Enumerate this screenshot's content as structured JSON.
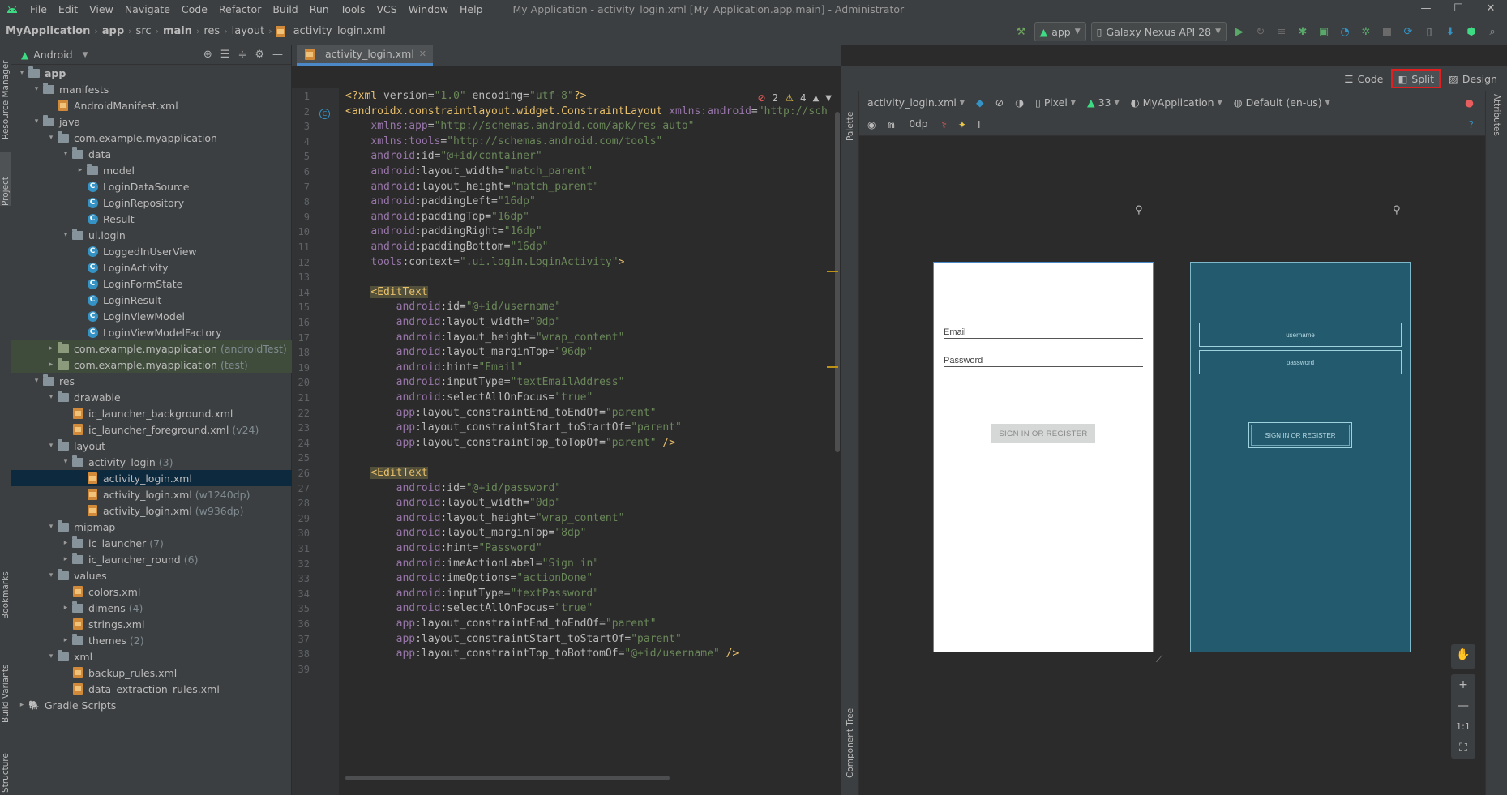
{
  "menubar": {
    "items": [
      "File",
      "Edit",
      "View",
      "Navigate",
      "Code",
      "Refactor",
      "Build",
      "Run",
      "Tools",
      "VCS",
      "Window",
      "Help"
    ],
    "window_title": "My Application - activity_login.xml [My_Application.app.main] - Administrator",
    "controls": [
      "—",
      "☐",
      "✕"
    ]
  },
  "breadcrumb": {
    "items": [
      "MyApplication",
      "app",
      "src",
      "main",
      "res",
      "layout",
      "activity_login.xml"
    ]
  },
  "toolbar": {
    "run_config": "app",
    "device": "Galaxy Nexus API 28"
  },
  "left_strip": {
    "top_tabs": [
      "Resource Manager",
      "Project"
    ],
    "bottom_tabs": [
      "Bookmarks",
      "Build Variants",
      "Structure"
    ]
  },
  "project": {
    "view_mode": "Android",
    "tree": [
      {
        "indent": 0,
        "arrow": "▾",
        "icon": "folder",
        "label": "app",
        "bold": true
      },
      {
        "indent": 1,
        "arrow": "▾",
        "icon": "folder",
        "label": "manifests"
      },
      {
        "indent": 2,
        "arrow": "",
        "icon": "xml",
        "label": "AndroidManifest.xml"
      },
      {
        "indent": 1,
        "arrow": "▾",
        "icon": "folder",
        "label": "java"
      },
      {
        "indent": 2,
        "arrow": "▾",
        "icon": "folder",
        "label": "com.example.myapplication"
      },
      {
        "indent": 3,
        "arrow": "▾",
        "icon": "folder",
        "label": "data"
      },
      {
        "indent": 4,
        "arrow": "▸",
        "icon": "folder",
        "label": "model"
      },
      {
        "indent": 4,
        "arrow": "",
        "icon": "class",
        "label": "LoginDataSource"
      },
      {
        "indent": 4,
        "arrow": "",
        "icon": "class",
        "label": "LoginRepository"
      },
      {
        "indent": 4,
        "arrow": "",
        "icon": "class",
        "label": "Result"
      },
      {
        "indent": 3,
        "arrow": "▾",
        "icon": "folder",
        "label": "ui.login"
      },
      {
        "indent": 4,
        "arrow": "",
        "icon": "class",
        "label": "LoggedInUserView"
      },
      {
        "indent": 4,
        "arrow": "",
        "icon": "class",
        "label": "LoginActivity"
      },
      {
        "indent": 4,
        "arrow": "",
        "icon": "class",
        "label": "LoginFormState"
      },
      {
        "indent": 4,
        "arrow": "",
        "icon": "class",
        "label": "LoginResult"
      },
      {
        "indent": 4,
        "arrow": "",
        "icon": "class",
        "label": "LoginViewModel"
      },
      {
        "indent": 4,
        "arrow": "",
        "icon": "class",
        "label": "LoginViewModelFactory"
      },
      {
        "indent": 2,
        "arrow": "▸",
        "icon": "folder-green",
        "label": "com.example.myapplication",
        "suffix": "(androidTest)",
        "alt": true
      },
      {
        "indent": 2,
        "arrow": "▸",
        "icon": "folder-green",
        "label": "com.example.myapplication",
        "suffix": "(test)",
        "alt": true
      },
      {
        "indent": 1,
        "arrow": "▾",
        "icon": "folder",
        "label": "res"
      },
      {
        "indent": 2,
        "arrow": "▾",
        "icon": "folder",
        "label": "drawable"
      },
      {
        "indent": 3,
        "arrow": "",
        "icon": "xml",
        "label": "ic_launcher_background.xml"
      },
      {
        "indent": 3,
        "arrow": "",
        "icon": "xml",
        "label": "ic_launcher_foreground.xml",
        "suffix": "(v24)"
      },
      {
        "indent": 2,
        "arrow": "▾",
        "icon": "folder",
        "label": "layout"
      },
      {
        "indent": 3,
        "arrow": "▾",
        "icon": "folder",
        "label": "activity_login",
        "suffix": "(3)"
      },
      {
        "indent": 4,
        "arrow": "",
        "icon": "xml",
        "label": "activity_login.xml",
        "selected": true
      },
      {
        "indent": 4,
        "arrow": "",
        "icon": "xml",
        "label": "activity_login.xml",
        "suffix": "(w1240dp)"
      },
      {
        "indent": 4,
        "arrow": "",
        "icon": "xml",
        "label": "activity_login.xml",
        "suffix": "(w936dp)"
      },
      {
        "indent": 2,
        "arrow": "▾",
        "icon": "folder",
        "label": "mipmap"
      },
      {
        "indent": 3,
        "arrow": "▸",
        "icon": "folder",
        "label": "ic_launcher",
        "suffix": "(7)"
      },
      {
        "indent": 3,
        "arrow": "▸",
        "icon": "folder",
        "label": "ic_launcher_round",
        "suffix": "(6)"
      },
      {
        "indent": 2,
        "arrow": "▾",
        "icon": "folder",
        "label": "values"
      },
      {
        "indent": 3,
        "arrow": "",
        "icon": "xml",
        "label": "colors.xml"
      },
      {
        "indent": 3,
        "arrow": "▸",
        "icon": "folder",
        "label": "dimens",
        "suffix": "(4)"
      },
      {
        "indent": 3,
        "arrow": "",
        "icon": "xml",
        "label": "strings.xml"
      },
      {
        "indent": 3,
        "arrow": "▸",
        "icon": "folder",
        "label": "themes",
        "suffix": "(2)"
      },
      {
        "indent": 2,
        "arrow": "▾",
        "icon": "folder",
        "label": "xml"
      },
      {
        "indent": 3,
        "arrow": "",
        "icon": "xml",
        "label": "backup_rules.xml"
      },
      {
        "indent": 3,
        "arrow": "",
        "icon": "xml",
        "label": "data_extraction_rules.xml"
      },
      {
        "indent": 0,
        "arrow": "▸",
        "icon": "gradle",
        "label": "Gradle Scripts"
      }
    ]
  },
  "editor": {
    "tab_label": "activity_login.xml",
    "inspections": {
      "errors": "2",
      "warnings": "4"
    },
    "line_numbers": [
      "1",
      "2",
      "3",
      "4",
      "5",
      "6",
      "7",
      "8",
      "9",
      "10",
      "11",
      "12",
      "13",
      "14",
      "15",
      "16",
      "17",
      "18",
      "19",
      "20",
      "21",
      "22",
      "23",
      "24",
      "25",
      "26",
      "27",
      "28",
      "29",
      "30",
      "31",
      "32",
      "33",
      "34",
      "35",
      "36",
      "37",
      "38",
      "39"
    ],
    "lines": [
      [
        [
          "kw",
          "<?xml "
        ],
        [
          "at",
          "version="
        ],
        [
          "st",
          "\"1.0\""
        ],
        [
          "at",
          " encoding="
        ],
        [
          "st",
          "\"utf-8\""
        ],
        [
          "kw",
          "?>"
        ]
      ],
      [
        [
          "tg",
          "<androidx.constraintlayout.widget.ConstraintLayout "
        ],
        [
          "ns",
          "xmlns:android"
        ],
        [
          "at",
          "="
        ],
        [
          "st",
          "\"http://sch"
        ]
      ],
      [
        [
          "at",
          "    "
        ],
        [
          "ns",
          "xmlns:app"
        ],
        [
          "at",
          "="
        ],
        [
          "st",
          "\"http://schemas.android.com/apk/res-auto\""
        ]
      ],
      [
        [
          "at",
          "    "
        ],
        [
          "ns",
          "xmlns:tools"
        ],
        [
          "at",
          "="
        ],
        [
          "st",
          "\"http://schemas.android.com/tools\""
        ]
      ],
      [
        [
          "at",
          "    "
        ],
        [
          "ns",
          "android"
        ],
        [
          "at",
          ":id="
        ],
        [
          "st",
          "\"@+id/container\""
        ]
      ],
      [
        [
          "at",
          "    "
        ],
        [
          "ns",
          "android"
        ],
        [
          "at",
          ":layout_width="
        ],
        [
          "st",
          "\"match_parent\""
        ]
      ],
      [
        [
          "at",
          "    "
        ],
        [
          "ns",
          "android"
        ],
        [
          "at",
          ":layout_height="
        ],
        [
          "st",
          "\"match_parent\""
        ]
      ],
      [
        [
          "at",
          "    "
        ],
        [
          "ns",
          "android"
        ],
        [
          "at",
          ":paddingLeft="
        ],
        [
          "st",
          "\"16dp\""
        ]
      ],
      [
        [
          "at",
          "    "
        ],
        [
          "ns",
          "android"
        ],
        [
          "at",
          ":paddingTop="
        ],
        [
          "st",
          "\"16dp\""
        ]
      ],
      [
        [
          "at",
          "    "
        ],
        [
          "ns",
          "android"
        ],
        [
          "at",
          ":paddingRight="
        ],
        [
          "st",
          "\"16dp\""
        ]
      ],
      [
        [
          "at",
          "    "
        ],
        [
          "ns",
          "android"
        ],
        [
          "at",
          ":paddingBottom="
        ],
        [
          "st",
          "\"16dp\""
        ]
      ],
      [
        [
          "at",
          "    "
        ],
        [
          "ns",
          "tools"
        ],
        [
          "at",
          ":context="
        ],
        [
          "st",
          "\".ui.login.LoginActivity\""
        ],
        [
          "tg",
          ">"
        ]
      ],
      [
        [
          "at",
          ""
        ]
      ],
      [
        [
          "at",
          "    "
        ],
        [
          "tg",
          "<EditText"
        ]
      ],
      [
        [
          "at",
          "        "
        ],
        [
          "ns",
          "android"
        ],
        [
          "at",
          ":id="
        ],
        [
          "st",
          "\"@+id/username\""
        ]
      ],
      [
        [
          "at",
          "        "
        ],
        [
          "ns",
          "android"
        ],
        [
          "at",
          ":layout_width="
        ],
        [
          "st",
          "\"0dp\""
        ]
      ],
      [
        [
          "at",
          "        "
        ],
        [
          "ns",
          "android"
        ],
        [
          "at",
          ":layout_height="
        ],
        [
          "st",
          "\"wrap_content\""
        ]
      ],
      [
        [
          "at",
          "        "
        ],
        [
          "ns",
          "android"
        ],
        [
          "at",
          ":layout_marginTop="
        ],
        [
          "st",
          "\"96dp\""
        ]
      ],
      [
        [
          "at",
          "        "
        ],
        [
          "ns",
          "android"
        ],
        [
          "at",
          ":hint="
        ],
        [
          "st",
          "\"Email\""
        ]
      ],
      [
        [
          "at",
          "        "
        ],
        [
          "ns",
          "android"
        ],
        [
          "at",
          ":inputType="
        ],
        [
          "st",
          "\"textEmailAddress\""
        ]
      ],
      [
        [
          "at",
          "        "
        ],
        [
          "ns",
          "android"
        ],
        [
          "at",
          ":selectAllOnFocus="
        ],
        [
          "st",
          "\"true\""
        ]
      ],
      [
        [
          "at",
          "        "
        ],
        [
          "ns",
          "app"
        ],
        [
          "at",
          ":layout_constraintEnd_toEndOf="
        ],
        [
          "st",
          "\"parent\""
        ]
      ],
      [
        [
          "at",
          "        "
        ],
        [
          "ns",
          "app"
        ],
        [
          "at",
          ":layout_constraintStart_toStartOf="
        ],
        [
          "st",
          "\"parent\""
        ]
      ],
      [
        [
          "at",
          "        "
        ],
        [
          "ns",
          "app"
        ],
        [
          "at",
          ":layout_constraintTop_toTopOf="
        ],
        [
          "st",
          "\"parent\""
        ],
        [
          "tg",
          " />"
        ]
      ],
      [
        [
          "at",
          ""
        ]
      ],
      [
        [
          "at",
          "    "
        ],
        [
          "tg",
          "<EditText"
        ]
      ],
      [
        [
          "at",
          "        "
        ],
        [
          "ns",
          "android"
        ],
        [
          "at",
          ":id="
        ],
        [
          "st",
          "\"@+id/password\""
        ]
      ],
      [
        [
          "at",
          "        "
        ],
        [
          "ns",
          "android"
        ],
        [
          "at",
          ":layout_width="
        ],
        [
          "st",
          "\"0dp\""
        ]
      ],
      [
        [
          "at",
          "        "
        ],
        [
          "ns",
          "android"
        ],
        [
          "at",
          ":layout_height="
        ],
        [
          "st",
          "\"wrap_content\""
        ]
      ],
      [
        [
          "at",
          "        "
        ],
        [
          "ns",
          "android"
        ],
        [
          "at",
          ":layout_marginTop="
        ],
        [
          "st",
          "\"8dp\""
        ]
      ],
      [
        [
          "at",
          "        "
        ],
        [
          "ns",
          "android"
        ],
        [
          "at",
          ":hint="
        ],
        [
          "st",
          "\"Password\""
        ]
      ],
      [
        [
          "at",
          "        "
        ],
        [
          "ns",
          "android"
        ],
        [
          "at",
          ":imeActionLabel="
        ],
        [
          "st",
          "\"Sign in\""
        ]
      ],
      [
        [
          "at",
          "        "
        ],
        [
          "ns",
          "android"
        ],
        [
          "at",
          ":imeOptions="
        ],
        [
          "st",
          "\"actionDone\""
        ]
      ],
      [
        [
          "at",
          "        "
        ],
        [
          "ns",
          "android"
        ],
        [
          "at",
          ":inputType="
        ],
        [
          "st",
          "\"textPassword\""
        ]
      ],
      [
        [
          "at",
          "        "
        ],
        [
          "ns",
          "android"
        ],
        [
          "at",
          ":selectAllOnFocus="
        ],
        [
          "st",
          "\"true\""
        ]
      ],
      [
        [
          "at",
          "        "
        ],
        [
          "ns",
          "app"
        ],
        [
          "at",
          ":layout_constraintEnd_toEndOf="
        ],
        [
          "st",
          "\"parent\""
        ]
      ],
      [
        [
          "at",
          "        "
        ],
        [
          "ns",
          "app"
        ],
        [
          "at",
          ":layout_constraintStart_toStartOf="
        ],
        [
          "st",
          "\"parent\""
        ]
      ],
      [
        [
          "at",
          "        "
        ],
        [
          "ns",
          "app"
        ],
        [
          "at",
          ":layout_constraintTop_toBottomOf="
        ],
        [
          "st",
          "\"@+id/username\""
        ],
        [
          "tg",
          " />"
        ]
      ],
      [
        [
          "at",
          ""
        ]
      ]
    ]
  },
  "view_modes": {
    "code": "Code",
    "split": "Split",
    "design": "Design",
    "active": "Split"
  },
  "design_toolbar": {
    "file": "activity_login.xml",
    "device": "Pixel",
    "api": "33",
    "theme": "MyApplication",
    "locale": "Default (en-us)",
    "margin": "0dp"
  },
  "side_panels": {
    "palette": "Palette",
    "component_tree": "Component Tree",
    "attributes": "Attributes"
  },
  "preview": {
    "email_hint": "Email",
    "password_hint": "Password",
    "button_label": "SIGN IN OR REGISTER",
    "blueprint_username": "username",
    "blueprint_password": "password",
    "blueprint_button": "SIGN IN OR REGISTER"
  },
  "zoom": {
    "zoom_in": "+",
    "zoom_out": "—",
    "actual_size": "1:1"
  },
  "colors": {
    "accent": "#4a88c7",
    "blueprint": "#235a6d",
    "highlight_border": "#e02020"
  }
}
